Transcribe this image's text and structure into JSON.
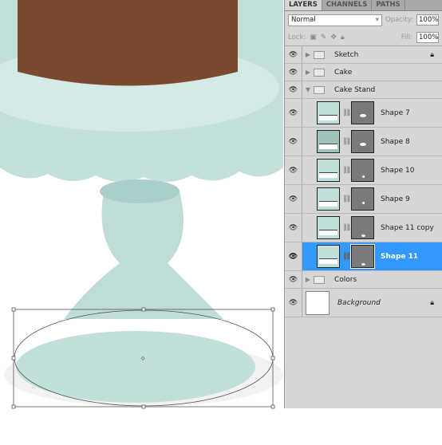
{
  "panel": {
    "tabs": [
      "LAYERS",
      "CHANNELS",
      "PATHS"
    ],
    "blend_mode": "Normal",
    "opacity_label": "Opacity:",
    "opacity": "100%",
    "lock_label": "Lock:",
    "fill_label": "Fill:",
    "fill": "100%",
    "layers": [
      {
        "name": "Sketch",
        "type": "group",
        "expanded": false,
        "locked": true
      },
      {
        "name": "Cake",
        "type": "group",
        "expanded": false
      },
      {
        "name": "Cake Stand",
        "type": "group",
        "expanded": true
      },
      {
        "name": "Shape 7",
        "type": "shape"
      },
      {
        "name": "Shape 8",
        "type": "shape"
      },
      {
        "name": "Shape 10",
        "type": "shape"
      },
      {
        "name": "Shape 9",
        "type": "shape"
      },
      {
        "name": "Shape 11 copy",
        "type": "shape"
      },
      {
        "name": "Shape 11",
        "type": "shape",
        "selected": true
      },
      {
        "name": "Colors",
        "type": "group",
        "expanded": false
      },
      {
        "name": "Background",
        "type": "background",
        "locked": true
      }
    ]
  },
  "colors": {
    "selection": "#3399ff",
    "stand": "#c1e0dc",
    "cake": "#7a4a2e"
  }
}
